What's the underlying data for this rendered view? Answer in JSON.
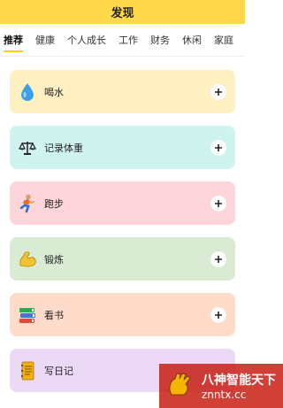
{
  "header": {
    "title": "发现"
  },
  "tabs": [
    {
      "label": "推荐",
      "active": true
    },
    {
      "label": "健康",
      "active": false
    },
    {
      "label": "个人成长",
      "active": false
    },
    {
      "label": "工作",
      "active": false
    },
    {
      "label": "财务",
      "active": false
    },
    {
      "label": "休闲",
      "active": false
    },
    {
      "label": "家庭",
      "active": false
    }
  ],
  "cards": [
    {
      "label": "喝水",
      "icon": "water-drop-icon",
      "bg": "#fff0c2"
    },
    {
      "label": "记录体重",
      "icon": "scale-icon",
      "bg": "#cff4f0"
    },
    {
      "label": "跑步",
      "icon": "runner-icon",
      "bg": "#ffd5dc"
    },
    {
      "label": "锻炼",
      "icon": "flexed-biceps-icon",
      "bg": "#d9ecd3"
    },
    {
      "label": "看书",
      "icon": "books-icon",
      "bg": "#ffdcc9"
    },
    {
      "label": "写日记",
      "icon": "notebook-icon",
      "bg": "#ecd9f6"
    }
  ],
  "watermark": {
    "line1": "八神智能天下",
    "line2": "znntx.cc"
  },
  "colors": {
    "accent": "#ffd84a",
    "tab_indicator": "#ffce00"
  }
}
